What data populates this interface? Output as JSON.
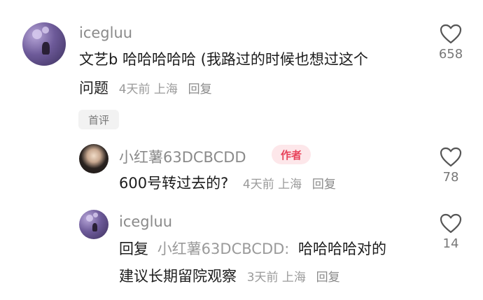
{
  "comments": [
    {
      "username": "icegluu",
      "text_line1": "文艺b 哈哈哈哈哈 (我路过的时候也想过这个",
      "text_line2": "问题",
      "meta": "4天前 上海",
      "reply_label": "回复",
      "badge": "首评",
      "likes": "658"
    },
    {
      "username": "小红薯63DCBCDD",
      "author_badge": "作者",
      "text": "600号转过去的?",
      "meta": "4天前 上海",
      "reply_label": "回复",
      "likes": "78"
    },
    {
      "username": "icegluu",
      "reply_prefix": "回复",
      "reply_target": "小红薯63DCBCDD:",
      "text_line1": "哈哈哈哈对的",
      "text_line2": "建议长期留院观察",
      "meta": "3天前 上海",
      "reply_label": "回复",
      "likes": "14"
    }
  ],
  "colors": {
    "author_badge_bg": "#fde7ea",
    "author_badge_text": "#e8425a",
    "username": "#8a8a8a",
    "meta": "#9a9a9a"
  },
  "icons": {
    "like": "heart-outline-icon"
  }
}
